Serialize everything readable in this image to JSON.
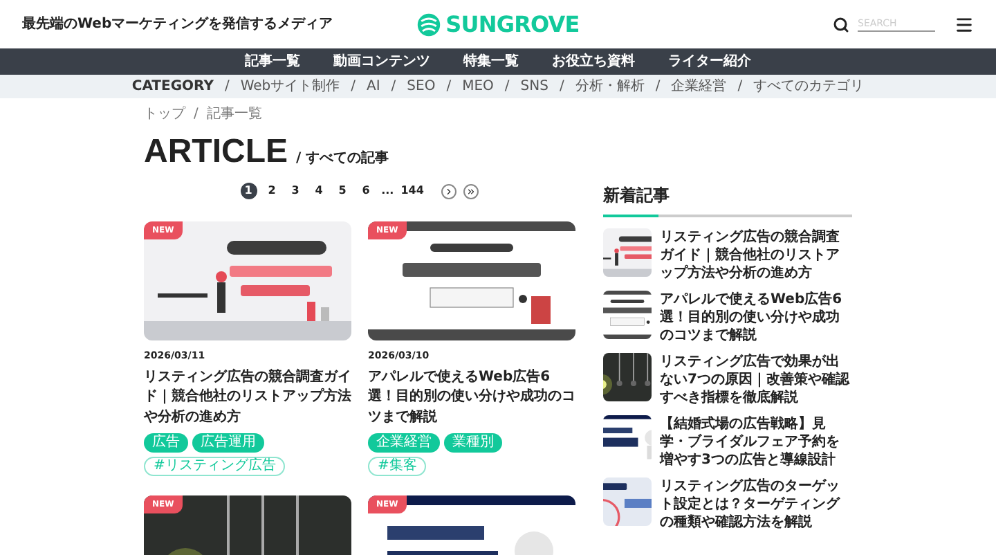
{
  "header": {
    "tagline": "最先端のWebマーケティングを発信するメディア",
    "logo": "SUNGROVE",
    "search": {
      "placeholder": "SEARCH"
    }
  },
  "nav": [
    "記事一覧",
    "動画コンテンツ",
    "特集一覧",
    "お役立ち資料",
    "ライター紹介"
  ],
  "category_bar": {
    "label": "CATEGORY",
    "separator": "/",
    "items": [
      "Webサイト制作",
      "AI",
      "SEO",
      "MEO",
      "SNS",
      "分析・解析",
      "企業経営",
      "すべてのカテゴリ"
    ]
  },
  "breadcrumb": {
    "separator": "/",
    "items": [
      "トップ",
      "記事一覧"
    ]
  },
  "page_title": {
    "title": "ARTICLE",
    "subtitle": "/ すべての記事"
  },
  "pagination": {
    "pages": [
      {
        "label": "1",
        "selected": true
      },
      {
        "label": "2",
        "selected": false
      },
      {
        "label": "3",
        "selected": false
      },
      {
        "label": "4",
        "selected": false
      },
      {
        "label": "5",
        "selected": false
      },
      {
        "label": "6",
        "selected": false
      }
    ],
    "ellipsis": "...",
    "last_page": "144"
  },
  "articles": [
    {
      "badge": "NEW",
      "date": "2026/03/11",
      "title": "リスティング広告の競合調査ガイド｜競合他社のリストアップ方法や分析の進め方",
      "tags": [
        "広告",
        "広告運用"
      ],
      "hashtags": [
        "#リスティング広告"
      ]
    },
    {
      "badge": "NEW",
      "date": "2026/03/10",
      "title": "アパレルで使えるWeb広告6選！目的別の使い分けや成功のコツまで解説",
      "tags": [
        "企業経営",
        "業種別"
      ],
      "hashtags": [
        "#集客"
      ]
    },
    {
      "badge": "NEW"
    },
    {
      "badge": "NEW"
    }
  ],
  "sidebar": {
    "heading": "新着記事",
    "items": [
      {
        "title": "リスティング広告の競合調査ガイド｜競合他社のリストアップ方法や分析の進め方"
      },
      {
        "title": "アパレルで使えるWeb広告6選！目的別の使い分けや成功のコツまで解説"
      },
      {
        "title": "リスティング広告で効果が出ない7つの原因｜改善策や確認すべき指標を徹底解説"
      },
      {
        "title": "【結婚式場の広告戦略】見学・ブライダルフェア予約を増やす3つの広告と導線設計"
      },
      {
        "title": "リスティング広告のターゲット設定とは？ターゲティングの種類や確認方法を解説"
      }
    ]
  }
}
